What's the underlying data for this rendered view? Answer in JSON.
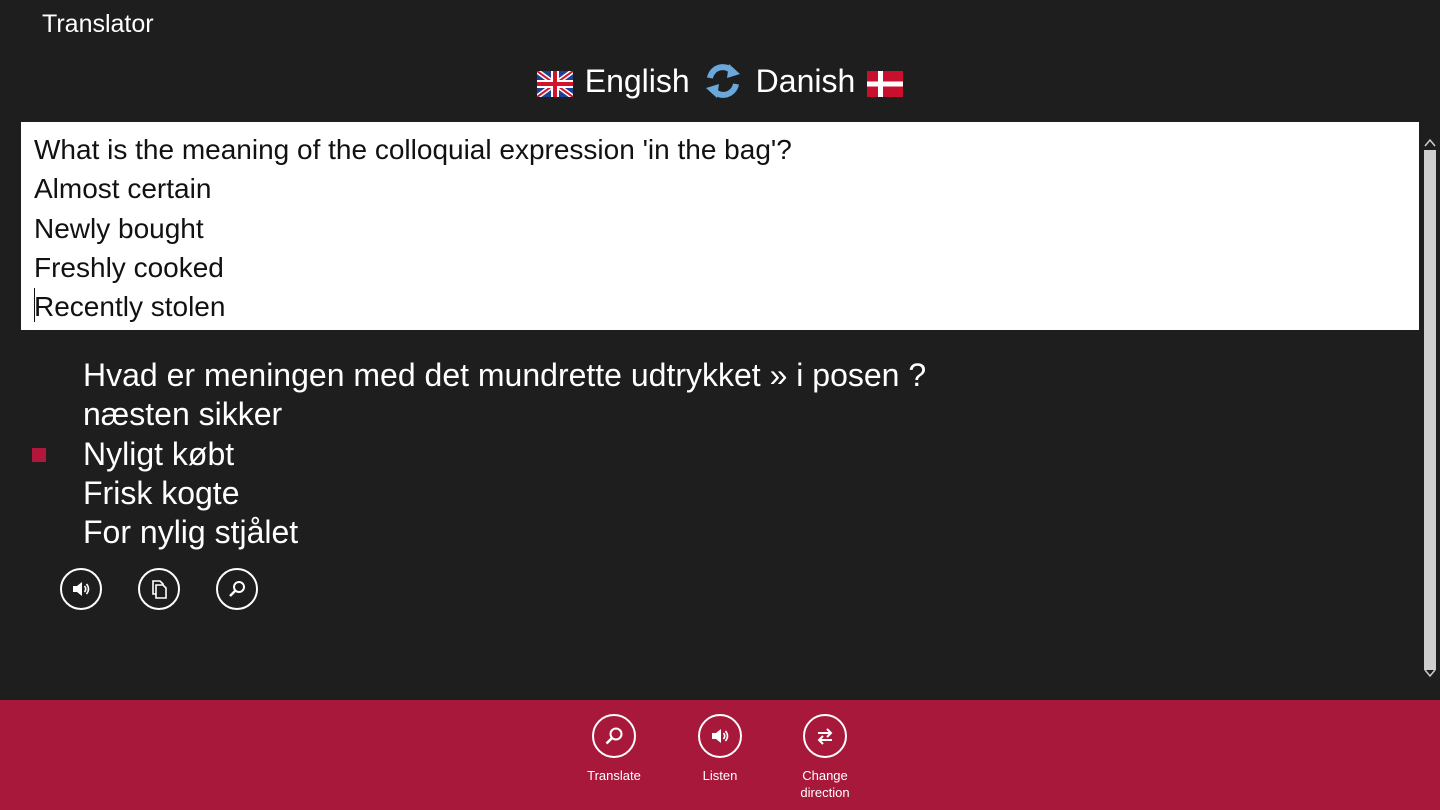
{
  "app": {
    "title": "Translator"
  },
  "languages": {
    "source": "English",
    "target": "Danish",
    "swap_icon": "swap-icon"
  },
  "source_text": {
    "lines": [
      "What is the meaning of the colloquial expression 'in the bag'?",
      "Almost certain",
      "Newly bought",
      "Freshly cooked",
      "Recently stolen"
    ]
  },
  "translation": {
    "lines": [
      "Hvad er meningen med det mundrette udtrykket » i posen ?",
      "næsten sikker",
      "Nyligt købt",
      "Frisk kogte",
      "For nylig stjålet"
    ],
    "highlight_color": "#b0173a"
  },
  "result_actions": {
    "listen_icon": "speaker-icon",
    "copy_icon": "copy-icon",
    "search_icon": "search-icon"
  },
  "app_bar": {
    "background": "#a8183a",
    "translate_label": "Translate",
    "listen_label": "Listen",
    "change_label_line1": "Change",
    "change_label_line2": "direction"
  }
}
